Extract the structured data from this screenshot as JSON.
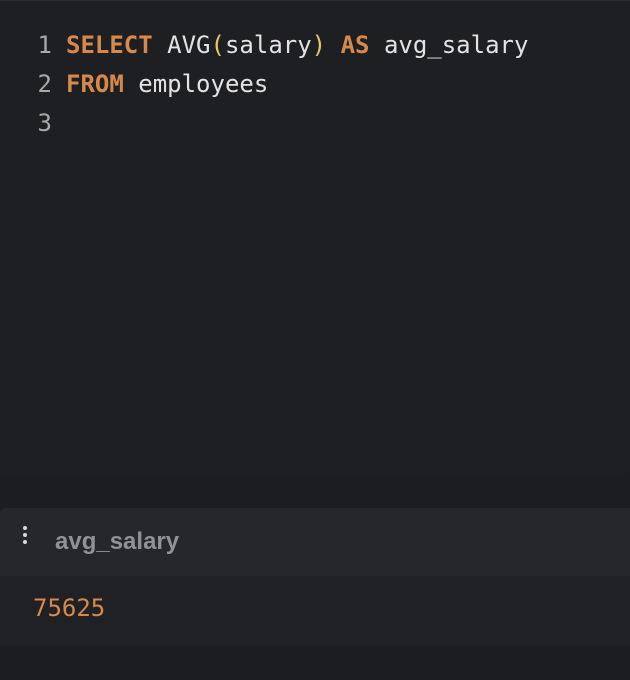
{
  "editor": {
    "lines": [
      {
        "number": "1",
        "tokens": {
          "select": "SELECT",
          "func": "AVG",
          "open_paren": "(",
          "arg": "salary",
          "close_paren": ")",
          "as": "AS",
          "alias": "avg_salary"
        }
      },
      {
        "number": "2",
        "tokens": {
          "from": "FROM",
          "table": "employees"
        }
      },
      {
        "number": "3"
      }
    ]
  },
  "results": {
    "menu_icon": "more-vertical-icon",
    "columns": [
      "avg_salary"
    ],
    "rows": [
      [
        "75625"
      ]
    ]
  },
  "colors": {
    "keyword": "#d8894a",
    "paren": "#e5c96b",
    "value": "#d8894a"
  }
}
